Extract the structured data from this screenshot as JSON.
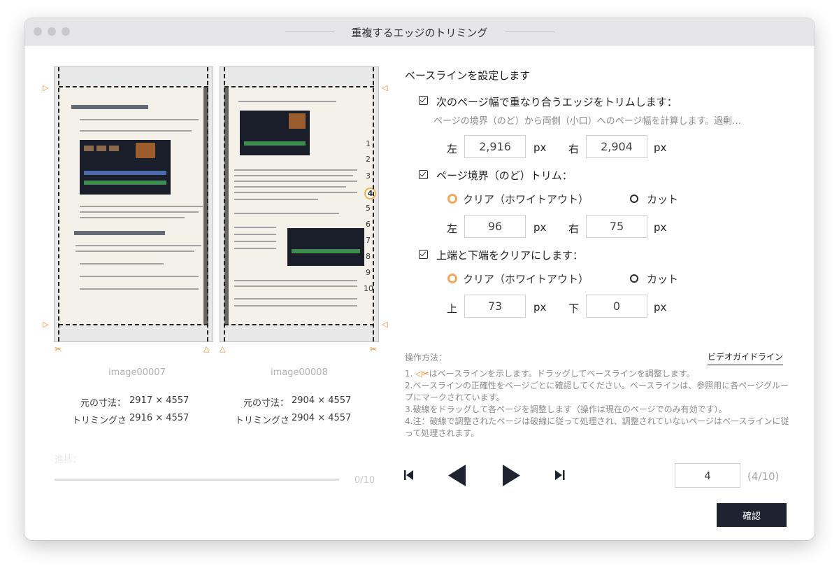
{
  "window": {
    "title": "重複するエッジのトリミング"
  },
  "pages": [
    {
      "name": "image00007",
      "orig_label": "元の寸法：",
      "orig_value": "2917 × 4557",
      "trim_label": "トリミングさ",
      "trim_value": "2916 × 4557"
    },
    {
      "name": "image00008",
      "orig_label": "元の寸法：",
      "orig_value": "2904 × 4557",
      "trim_label": "トリミングさ",
      "trim_value": "2904 × 4557",
      "margin_numbers": [
        "1",
        "2",
        "3",
        "4",
        "5",
        "6",
        "7",
        "8",
        "9",
        "10"
      ]
    }
  ],
  "progress": {
    "label": "進捗：",
    "value": "0/10",
    "fraction": 0
  },
  "settings": {
    "heading": "ベースラインを設定します",
    "overlap": {
      "label": "次のページ幅で重なり合うエッジをトリムします：",
      "checked": true,
      "description": "ページの境界（のど）から両側（小口）へのページ幅を計算します。過剰…",
      "left_label": "左",
      "left_value": "2,916",
      "right_label": "右",
      "right_value": "2,904",
      "unit": "px"
    },
    "gutter": {
      "label": "ページ境界（のど）トリム：",
      "checked": true,
      "option_clear": "クリア（ホワイトアウト）",
      "option_cut": "カット",
      "selected": "clear",
      "left_label": "左",
      "left_value": "96",
      "right_label": "右",
      "right_value": "75",
      "unit": "px"
    },
    "topbottom": {
      "label": "上端と下端をクリアにします：",
      "checked": true,
      "option_clear": "クリア（ホワイトアウト）",
      "option_cut": "カット",
      "selected": "clear",
      "top_label": "上",
      "top_value": "73",
      "bottom_label": "下",
      "bottom_value": "0",
      "unit": "px"
    }
  },
  "instructions": {
    "title": "操作方法：",
    "guide_link": "ビデオガイドライン",
    "item1_prefix": "1. ",
    "item1_text": "はベースラインを示します。ドラッグしてベースラインを調整します。",
    "item2": "2.ベースラインの正確性をページごとに確認してください。ベースラインは、参照用に各ページグループにマークされています。",
    "item3": "3.破線をドラッグして各ページを調整します（操作は現在のページでのみ有効です）。",
    "item4": "4.注：破線で調整されたページは破線に従って処理され、調整されていないページはベースラインに従って処理されます。"
  },
  "navigation": {
    "current_page": "4",
    "page_total": "(4/10)"
  },
  "actions": {
    "confirm": "確認"
  },
  "colors": {
    "accent": "#f08a28",
    "primary_button": "#1e2331"
  },
  "icons": {
    "marker": "triangle-marker-icon",
    "scissor": "scissor-icon"
  }
}
